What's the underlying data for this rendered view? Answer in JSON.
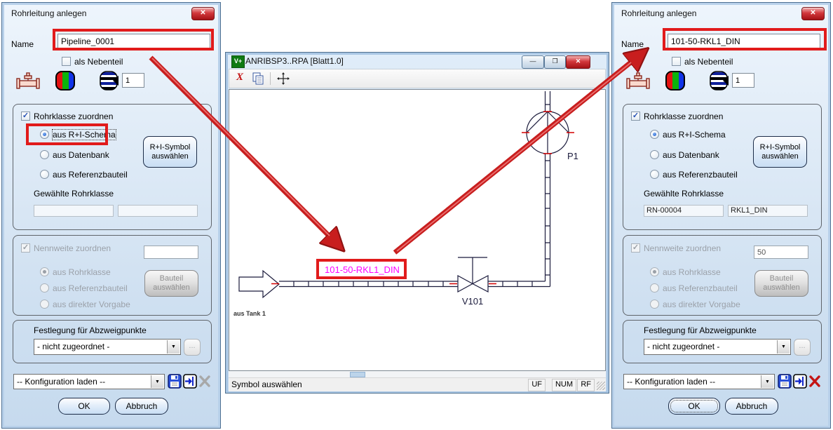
{
  "icons": {
    "close": "✕",
    "minimize": "—",
    "restore": "❐",
    "combo_arrow": "▼",
    "ellipsis": "...",
    "check": "✓",
    "delete_x": "X"
  },
  "annotation": {
    "box_color": "#e11b1b",
    "arrow_color": "#c81e1e"
  },
  "left_dialog": {
    "title": "Rohrleitung anlegen",
    "name_label": "Name",
    "name_value": "Pipeline_0001",
    "nebenteil_label": "als Nebenteil",
    "segment_count": "1",
    "rohrklasse": {
      "checkbox": "Rohrklasse zuordnen",
      "opt_schema": "aus R+I-Schema",
      "opt_datenbank": "aus Datenbank",
      "opt_referenz": "aus Referenzbauteil",
      "symbol_button": "R+I-Symbol auswählen",
      "selected_label": "Gewählte Rohrklasse",
      "class_id": "",
      "class_name": ""
    },
    "nennweite": {
      "checkbox": "Nennweite zuordnen",
      "value": "",
      "opt_rohrklasse": "aus Rohrklasse",
      "opt_referenz": "aus Referenzbauteil",
      "opt_direkt": "aus direkter Vorgabe",
      "bauteil_button": "Bauteil auswählen"
    },
    "abzweig": {
      "label": "Festlegung für Abzweigpunkte",
      "value": "- nicht zugeordnet -"
    },
    "config_value": "-- Konfiguration laden --",
    "ok": "OK",
    "cancel": "Abbruch"
  },
  "right_dialog": {
    "title": "Rohrleitung anlegen",
    "name_label": "Name",
    "name_value": "101-50-RKL1_DIN",
    "nebenteil_label": "als Nebenteil",
    "segment_count": "1",
    "rohrklasse": {
      "checkbox": "Rohrklasse zuordnen",
      "opt_schema": "aus R+I-Schema",
      "opt_datenbank": "aus Datenbank",
      "opt_referenz": "aus Referenzbauteil",
      "symbol_button": "R+I-Symbol auswählen",
      "selected_label": "Gewählte Rohrklasse",
      "class_id": "RN-00004",
      "class_name": "RKL1_DIN"
    },
    "nennweite": {
      "checkbox": "Nennweite zuordnen",
      "value": "50",
      "opt_rohrklasse": "aus Rohrklasse",
      "opt_referenz": "aus Referenzbauteil",
      "opt_direkt": "aus direkter Vorgabe",
      "bauteil_button": "Bauteil auswählen"
    },
    "abzweig": {
      "label": "Festlegung für Abzweigpunkte",
      "value": "- nicht zugeordnet -"
    },
    "config_value": "-- Konfiguration laden --",
    "ok": "OK",
    "cancel": "Abbruch"
  },
  "window": {
    "icon_label": "V+",
    "title": "ANRIBSP3..RPA [Blatt1.0]",
    "status_message": "Symbol auswählen",
    "status_panes": [
      "UF",
      "NUM",
      "RF"
    ],
    "schematic": {
      "pipeline_label": "101-50-RKL1_DIN",
      "valve_tag": "V101",
      "pump_tag": "P1",
      "source_note": "aus Tank 1",
      "line_color": "#1b1b3c",
      "label_color": "#ff00ff"
    }
  }
}
